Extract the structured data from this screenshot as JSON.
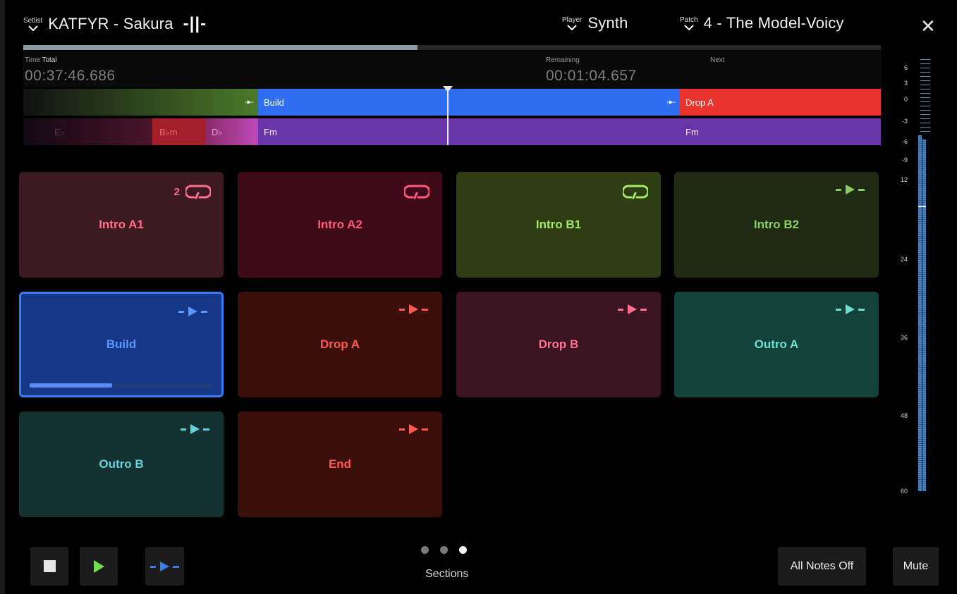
{
  "header": {
    "setlist_label": "Setlist",
    "song": "KATFYR - Sakura",
    "beat_indicator": "-||-",
    "player_label": "Player",
    "player": "Synth",
    "patch_label": "Patch",
    "patch": "4 - The Model-Voicy",
    "close": "✕"
  },
  "song_progress": 0.46,
  "time": {
    "time_label": "Time",
    "total_label": "Total",
    "total": "00:37:46.686",
    "remaining_label": "Remaining",
    "remaining": "00:01:04.657",
    "next_label": "Next"
  },
  "timeline": {
    "sections": [
      {
        "label": "",
        "color": "#4a7a2a"
      },
      {
        "label": "Build",
        "color": "#2f6ef0"
      },
      {
        "label": "Drop A",
        "color": "#e8342c"
      }
    ],
    "chords": [
      {
        "label": "E♭",
        "color": "#3a1428"
      },
      {
        "label": "B♭m",
        "color": "#a3202a"
      },
      {
        "label": "D♭",
        "color": "#b03fae"
      },
      {
        "label": "Fm",
        "color": "#6a35a8"
      },
      {
        "label": "Fm",
        "color": "#6a35a8"
      }
    ]
  },
  "pads": [
    {
      "label": "Intro A1",
      "bg": "#3d1a22",
      "fg": "#ff6f8e",
      "icon": "loop-icon",
      "count": "2"
    },
    {
      "label": "Intro A2",
      "bg": "#3f0b18",
      "fg": "#ff5a7a",
      "icon": "loop-icon",
      "count": ""
    },
    {
      "label": "Intro B1",
      "bg": "#2e3d14",
      "fg": "#a6e86a",
      "icon": "loop-icon",
      "count": ""
    },
    {
      "label": "Intro B2",
      "bg": "#1f2a14",
      "fg": "#8ccc63",
      "icon": "next-section-icon",
      "count": ""
    },
    {
      "label": "Build",
      "bg": "#163686",
      "fg": "#5b95ff",
      "icon": "next-section-icon",
      "count": "",
      "progress": 0.45
    },
    {
      "label": "Drop A",
      "bg": "#3b0f0c",
      "fg": "#ff5a52",
      "icon": "next-section-icon",
      "count": ""
    },
    {
      "label": "Drop B",
      "bg": "#3a1420",
      "fg": "#ff6f8e",
      "icon": "next-section-icon",
      "count": ""
    },
    {
      "label": "Outro A",
      "bg": "#14423a",
      "fg": "#6de0d2",
      "icon": "next-section-icon",
      "count": ""
    },
    {
      "label": "Outro B",
      "bg": "#143232",
      "fg": "#68d2dc",
      "icon": "next-section-icon",
      "count": ""
    },
    {
      "label": "End",
      "bg": "#3b0f0c",
      "fg": "#ff5a52",
      "icon": "next-section-icon",
      "count": ""
    }
  ],
  "meter": {
    "labels": [
      "6",
      "3",
      "0",
      "-3",
      "-6",
      "-9",
      "12",
      "24",
      "36",
      "48",
      "60"
    ],
    "level_left": 0.0,
    "level_right": 0.0
  },
  "bottom": {
    "sections_label": "Sections",
    "page_dots": [
      false,
      false,
      true
    ],
    "all_notes_off": "All Notes Off",
    "mute": "Mute"
  },
  "colors": {
    "play": "#6ee04a",
    "next": "#3d7bf0"
  }
}
